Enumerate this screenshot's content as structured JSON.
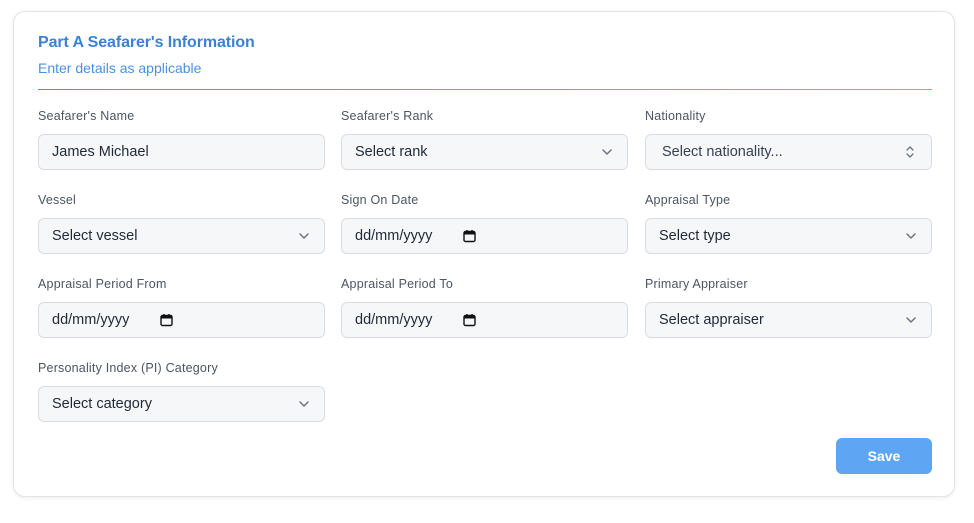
{
  "section": {
    "title": "Part A Seafarer's Information",
    "subtitle": "Enter details as applicable"
  },
  "fields": {
    "seafarer_name": {
      "label": "Seafarer's Name",
      "value": "James Michael"
    },
    "seafarer_rank": {
      "label": "Seafarer's Rank",
      "value": "Select rank"
    },
    "nationality": {
      "label": "Nationality",
      "value": "Select nationality..."
    },
    "vessel": {
      "label": "Vessel",
      "value": "Select vessel"
    },
    "sign_on_date": {
      "label": "Sign On Date",
      "value": "dd/mm/yyyy"
    },
    "appraisal_type": {
      "label": "Appraisal Type",
      "value": "Select type"
    },
    "appraisal_from": {
      "label": "Appraisal Period From",
      "value": "dd/mm/yyyy"
    },
    "appraisal_to": {
      "label": "Appraisal Period To",
      "value": "dd/mm/yyyy"
    },
    "primary_appraiser": {
      "label": "Primary Appraiser",
      "value": "Select appraiser"
    },
    "pi_category": {
      "label": "Personality Index (PI) Category",
      "value": "Select category"
    }
  },
  "actions": {
    "save_label": "Save"
  },
  "icons": {
    "select": "chevron-down-icon",
    "date": "calendar-icon",
    "searchable_select": "updown-chevron-icon"
  },
  "colors": {
    "accent": "#3b82d6",
    "button": "#5ea6f4"
  }
}
